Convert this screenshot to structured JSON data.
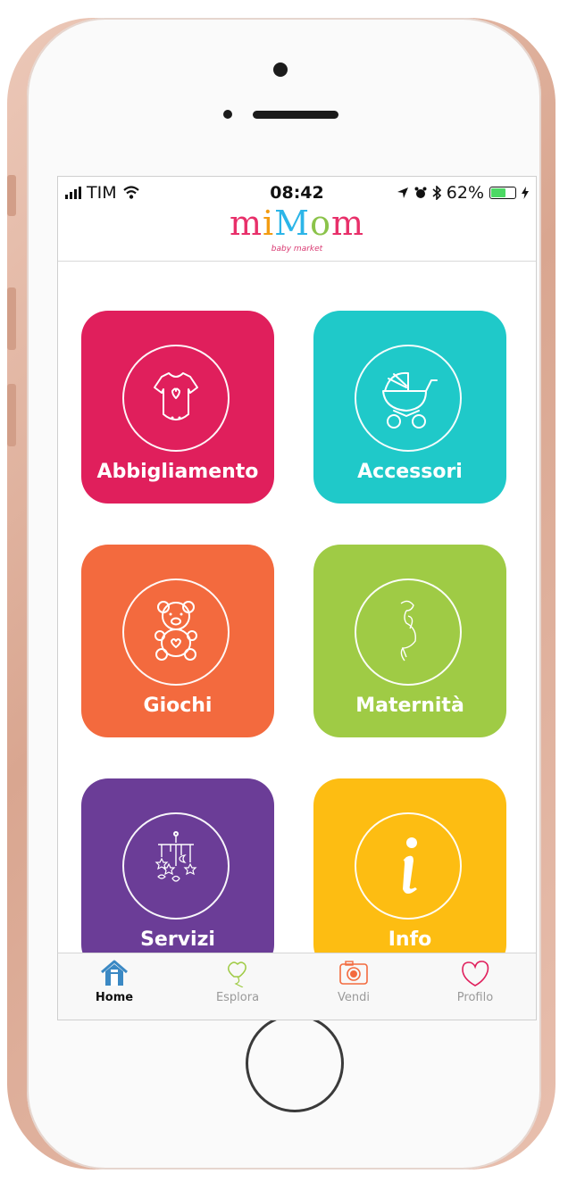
{
  "status": {
    "carrier": "TIM",
    "time": "08:42",
    "battery_percent_text": "62%",
    "battery_level": 0.62
  },
  "header": {
    "logo_letters": [
      "m",
      "i",
      "M",
      "o",
      "m"
    ],
    "logo_colors": [
      "#e8306a",
      "#f39c12",
      "#2cb5e8",
      "#8bc34a",
      "#e8306a"
    ],
    "tagline": "baby market"
  },
  "categories": [
    {
      "label": "Abbigliamento",
      "color": "#e01f5c",
      "icon": "onesie-icon"
    },
    {
      "label": "Accessori",
      "color": "#1fc9c9",
      "icon": "stroller-icon"
    },
    {
      "label": "Giochi",
      "color": "#f36a3e",
      "icon": "teddy-bear-icon"
    },
    {
      "label": "Maternità",
      "color": "#9fcb45",
      "icon": "pregnant-woman-icon"
    },
    {
      "label": "Servizi",
      "color": "#6b3d97",
      "icon": "baby-mobile-icon"
    },
    {
      "label": "Info",
      "color": "#fdbd12",
      "icon": "info-icon"
    }
  ],
  "tabs": [
    {
      "label": "Home",
      "icon": "home-icon",
      "active": true,
      "color": "#3b89c4"
    },
    {
      "label": "Esplora",
      "icon": "balloon-icon",
      "active": false,
      "color": "#9fcb45"
    },
    {
      "label": "Vendi",
      "icon": "camera-icon",
      "active": false,
      "color": "#f36a3e"
    },
    {
      "label": "Profilo",
      "icon": "heart-icon",
      "active": false,
      "color": "#e01f5c"
    }
  ]
}
